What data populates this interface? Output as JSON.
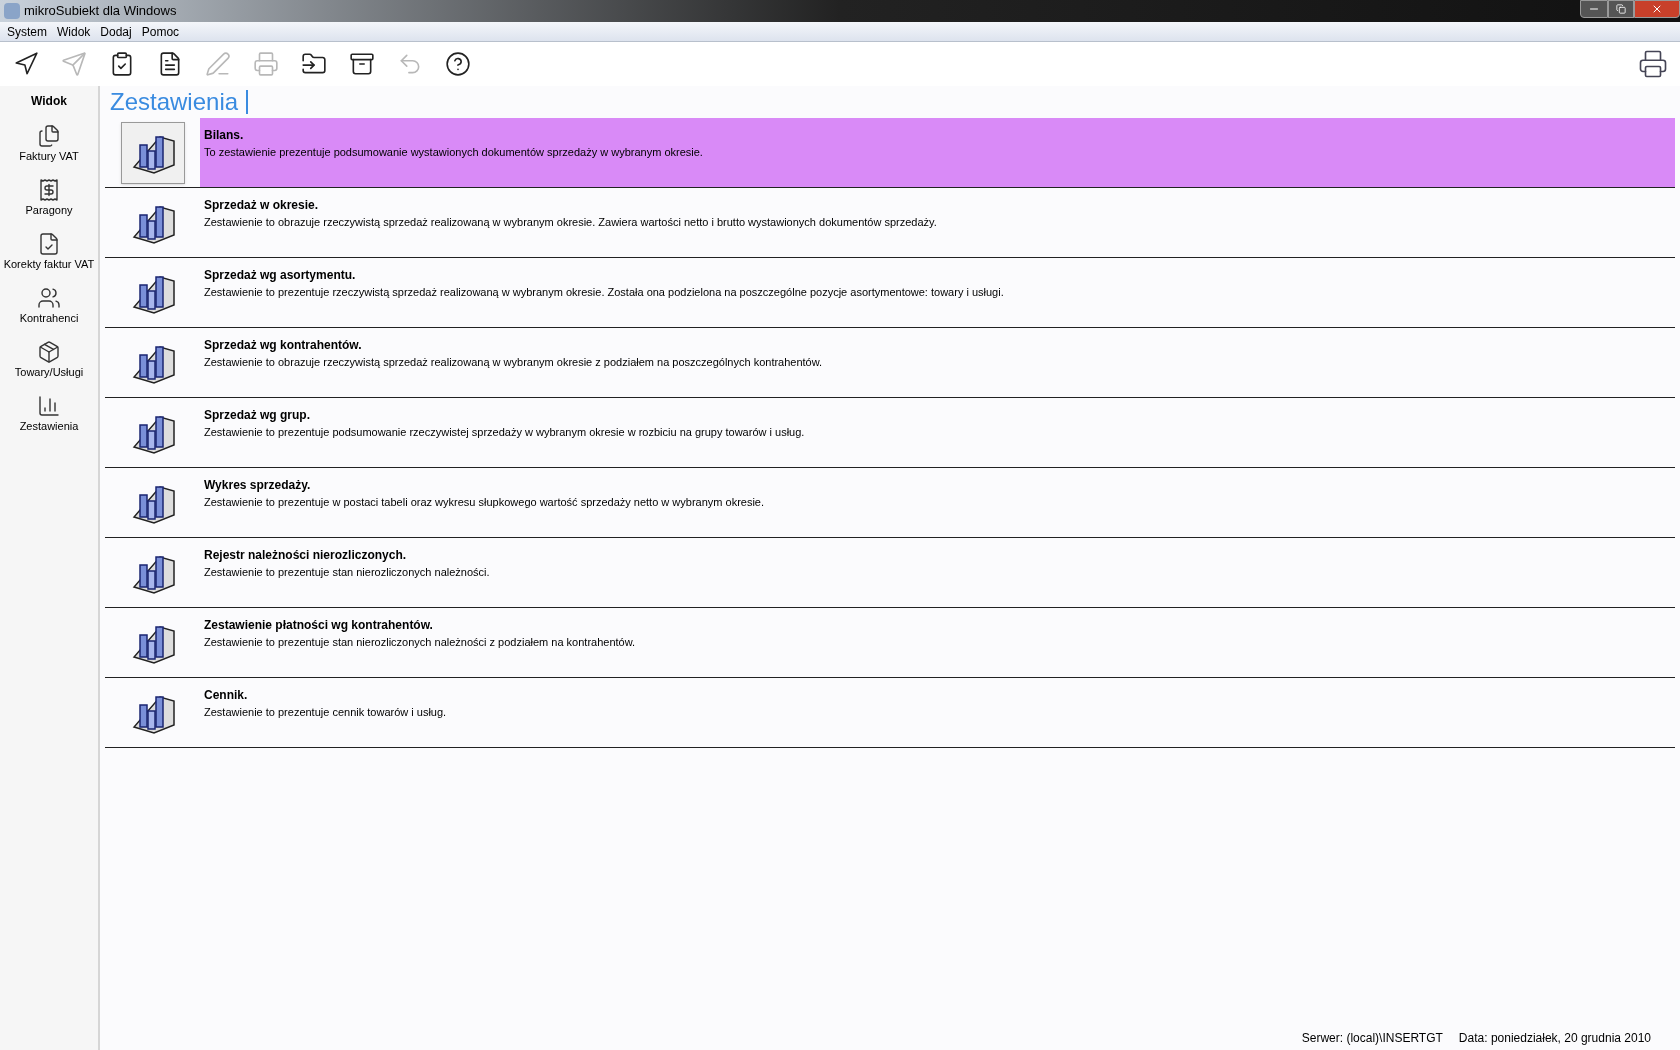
{
  "window": {
    "title": "mikroSubiekt dla Windows"
  },
  "menu": [
    "System",
    "Widok",
    "Dodaj",
    "Pomoc"
  ],
  "toolbar": [
    {
      "kind": "back",
      "disabled": false
    },
    {
      "kind": "forward",
      "disabled": true
    },
    {
      "kind": "clipboard",
      "disabled": false
    },
    {
      "kind": "document",
      "disabled": false
    },
    {
      "kind": "pen",
      "disabled": true
    },
    {
      "kind": "printer",
      "disabled": true
    },
    {
      "kind": "folder",
      "disabled": false
    },
    {
      "kind": "archive",
      "disabled": false
    },
    {
      "kind": "undo",
      "disabled": true
    },
    {
      "kind": "help",
      "disabled": false
    }
  ],
  "sidebar": {
    "title": "Widok",
    "items": [
      {
        "kind": "invoice",
        "label": "Faktury VAT"
      },
      {
        "kind": "receipt",
        "label": "Paragony"
      },
      {
        "kind": "correction",
        "label": "Korekty faktur VAT"
      },
      {
        "kind": "contractor",
        "label": "Kontrahenci"
      },
      {
        "kind": "goods",
        "label": "Towary/Usługi"
      },
      {
        "kind": "report",
        "label": "Zestawienia"
      }
    ]
  },
  "page": {
    "title": "Zestawienia"
  },
  "reports": [
    {
      "title": "Bilans.",
      "description": "To zestawienie prezentuje podsumowanie wystawionych dokumentów sprzedaży w wybranym okresie.",
      "selected": true
    },
    {
      "title": "Sprzedaż w okresie.",
      "description": "Zestawienie to obrazuje rzeczywistą sprzedaż realizowaną w wybranym okresie. Zawiera wartości netto i brutto wystawionych dokumentów sprzedaży.",
      "selected": false
    },
    {
      "title": "Sprzedaż wg asortymentu.",
      "description": "Zestawienie to prezentuje rzeczywistą sprzedaż realizowaną w wybranym okresie. Została ona podzielona na poszczególne pozycje asortymentowe: towary i usługi.",
      "selected": false
    },
    {
      "title": "Sprzedaż wg kontrahentów.",
      "description": "Zestawienie to obrazuje rzeczywistą sprzedaż realizowaną w wybranym okresie z podziałem na poszczególnych kontrahentów.",
      "selected": false
    },
    {
      "title": "Sprzedaż wg grup.",
      "description": "Zestawienie to prezentuje podsumowanie rzeczywistej sprzedaży w wybranym okresie w rozbiciu na grupy towarów i usług.",
      "selected": false
    },
    {
      "title": "Wykres sprzedaży.",
      "description": "Zestawienie to prezentuje w postaci tabeli oraz wykresu słupkowego wartość sprzedaży netto w wybranym okresie.",
      "selected": false
    },
    {
      "title": "Rejestr należności nierozliczonych.",
      "description": "Zestawienie to prezentuje stan nierozliczonych należności.",
      "selected": false
    },
    {
      "title": "Zestawienie płatności wg kontrahentów.",
      "description": "Zestawienie to prezentuje stan nierozliczonych należności z podziałem na kontrahentów.",
      "selected": false
    },
    {
      "title": "Cennik.",
      "description": "Zestawienie to prezentuje cennik towarów i usług.",
      "selected": false
    }
  ],
  "status_bar": {
    "server": "Serwer: (local)\\INSERTGT",
    "date": "Data: poniedziałek, 20 grudnia 2010"
  }
}
